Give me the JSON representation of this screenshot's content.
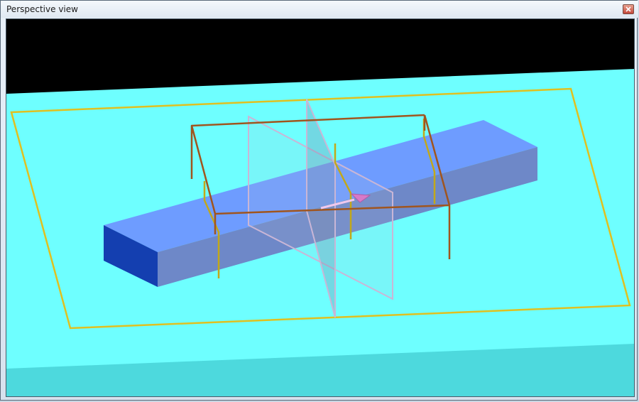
{
  "window": {
    "title": "Perspective view",
    "close_icon": "close-icon"
  },
  "scene": {
    "sky_color": "#000000",
    "ground_color": "#6effff",
    "ground_shadow_color": "#4dd9dd",
    "frame_color": "#e0c020",
    "box_top_color": "#6e9cff",
    "box_front_color": "#6e88c8",
    "box_end_color": "#143fb0",
    "truss_color": "#a0551e",
    "post_color": "#c2a81a",
    "plane_color": "#c9b6d6",
    "marker_color": "#d77ac8"
  }
}
